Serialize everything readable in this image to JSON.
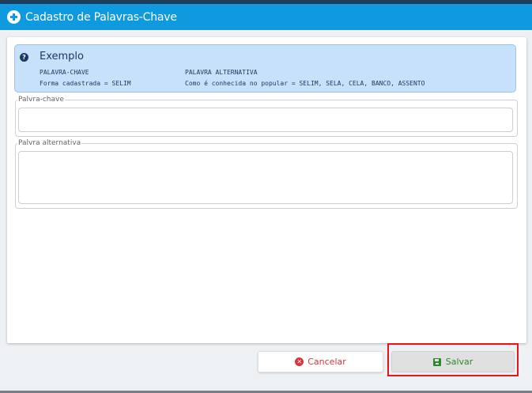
{
  "header": {
    "title": "Cadastro de Palavras-Chave"
  },
  "info": {
    "heading": "Exemplo",
    "col1_header": "PALAVRA-CHAVE",
    "col1_text": "Forma cadastrada = SELIM",
    "col2_header": "PALAVRA ALTERNATIVA",
    "col2_text": "Como é conhecida no popular = SELIM, SELA, CELA, BANCO, ASSENTO"
  },
  "fields": {
    "keyword_label": "Palvra-chave",
    "keyword_value": "",
    "alternative_label": "Palvra alternativa",
    "alternative_value": ""
  },
  "actions": {
    "cancel_label": "Cancelar",
    "save_label": "Salvar"
  },
  "colors": {
    "header_bg": "#0f9ae0",
    "cancel_text": "#d9333b",
    "save_text": "#2b8a2b",
    "highlight": "#e8141b"
  },
  "icons": [
    "plus-circle-icon",
    "question-circle-icon",
    "times-circle-icon",
    "floppy-disk-icon"
  ]
}
